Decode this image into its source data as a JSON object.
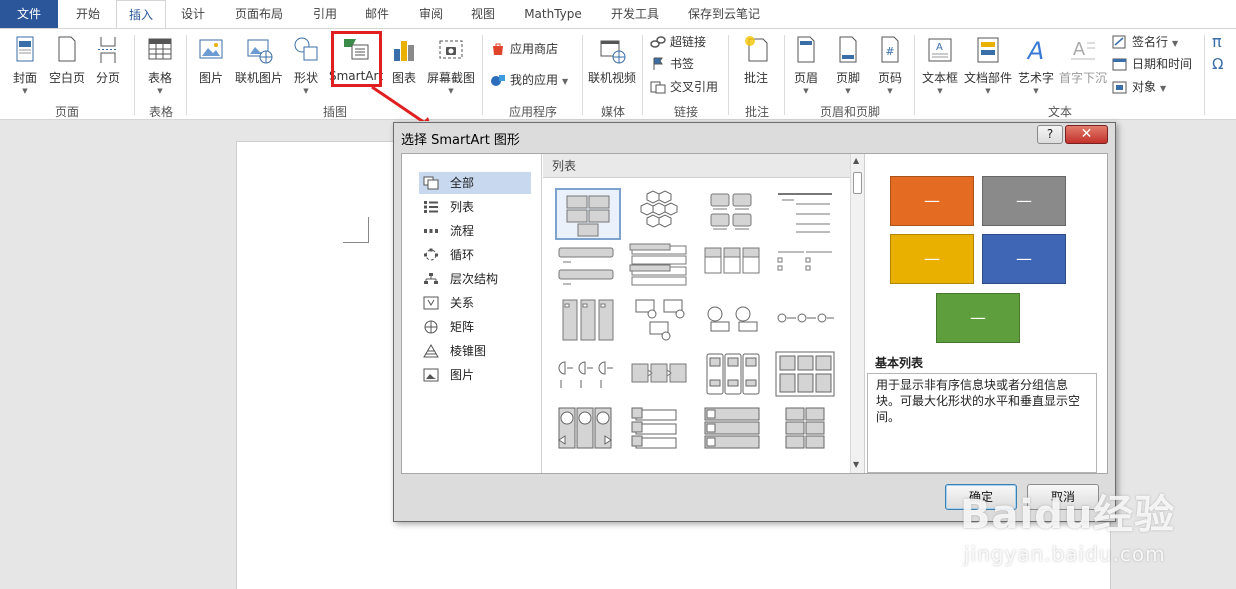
{
  "tabs": [
    "文件",
    "开始",
    "插入",
    "设计",
    "页面布局",
    "引用",
    "邮件",
    "审阅",
    "视图",
    "MathType",
    "开发工具",
    "保存到云笔记"
  ],
  "ribbon": {
    "cover": "封面",
    "blank_page": "空白页",
    "page_break": "分页",
    "table": "表格",
    "picture": "图片",
    "online_picture": "联机图片",
    "shapes": "形状",
    "smartart": "SmartArt",
    "chart": "图表",
    "screenshot": "屏幕截图",
    "app_store": "应用商店",
    "my_apps": "我的应用",
    "online_video": "联机视频",
    "hyperlink": "超链接",
    "bookmark": "书签",
    "cross_ref": "交叉引用",
    "comment": "批注",
    "header": "页眉",
    "footer": "页脚",
    "page_number": "页码",
    "textbox": "文本框",
    "quick_parts": "文档部件",
    "wordart": "艺术字",
    "dropcap": "首字下沉",
    "signature": "签名行",
    "datetime": "日期和时间",
    "object": "对象",
    "pi": "π",
    "omega": "Ω",
    "groups": {
      "pages": "页面",
      "tables": "表格",
      "illustrations": "插图",
      "apps": "应用程序",
      "media": "媒体",
      "links": "链接",
      "comments": "批注",
      "header_footer": "页眉和页脚",
      "text": "文本"
    }
  },
  "dialog": {
    "title": "选择 SmartArt 图形",
    "help": "?",
    "close": "✕",
    "categories": [
      "全部",
      "列表",
      "流程",
      "循环",
      "层次结构",
      "关系",
      "矩阵",
      "棱锥图",
      "图片"
    ],
    "gallery_header": "列表",
    "preview_name": "基本列表",
    "preview_desc": "用于显示非有序信息块或者分组信息块。可最大化形状的水平和垂直显示空间。",
    "preview_block_text": "—",
    "ok": "确定",
    "cancel": "取消"
  },
  "colors": {
    "file_tab": "#2b579a",
    "highlight": "#e02020",
    "orange": "#e46c22",
    "gray": "#8a8a8a",
    "yellow": "#e9b000",
    "blue": "#3f66b4",
    "green": "#5f9e3c"
  },
  "watermark": {
    "brand": "Baidu经验",
    "url": "jingyan.baidu.com"
  }
}
